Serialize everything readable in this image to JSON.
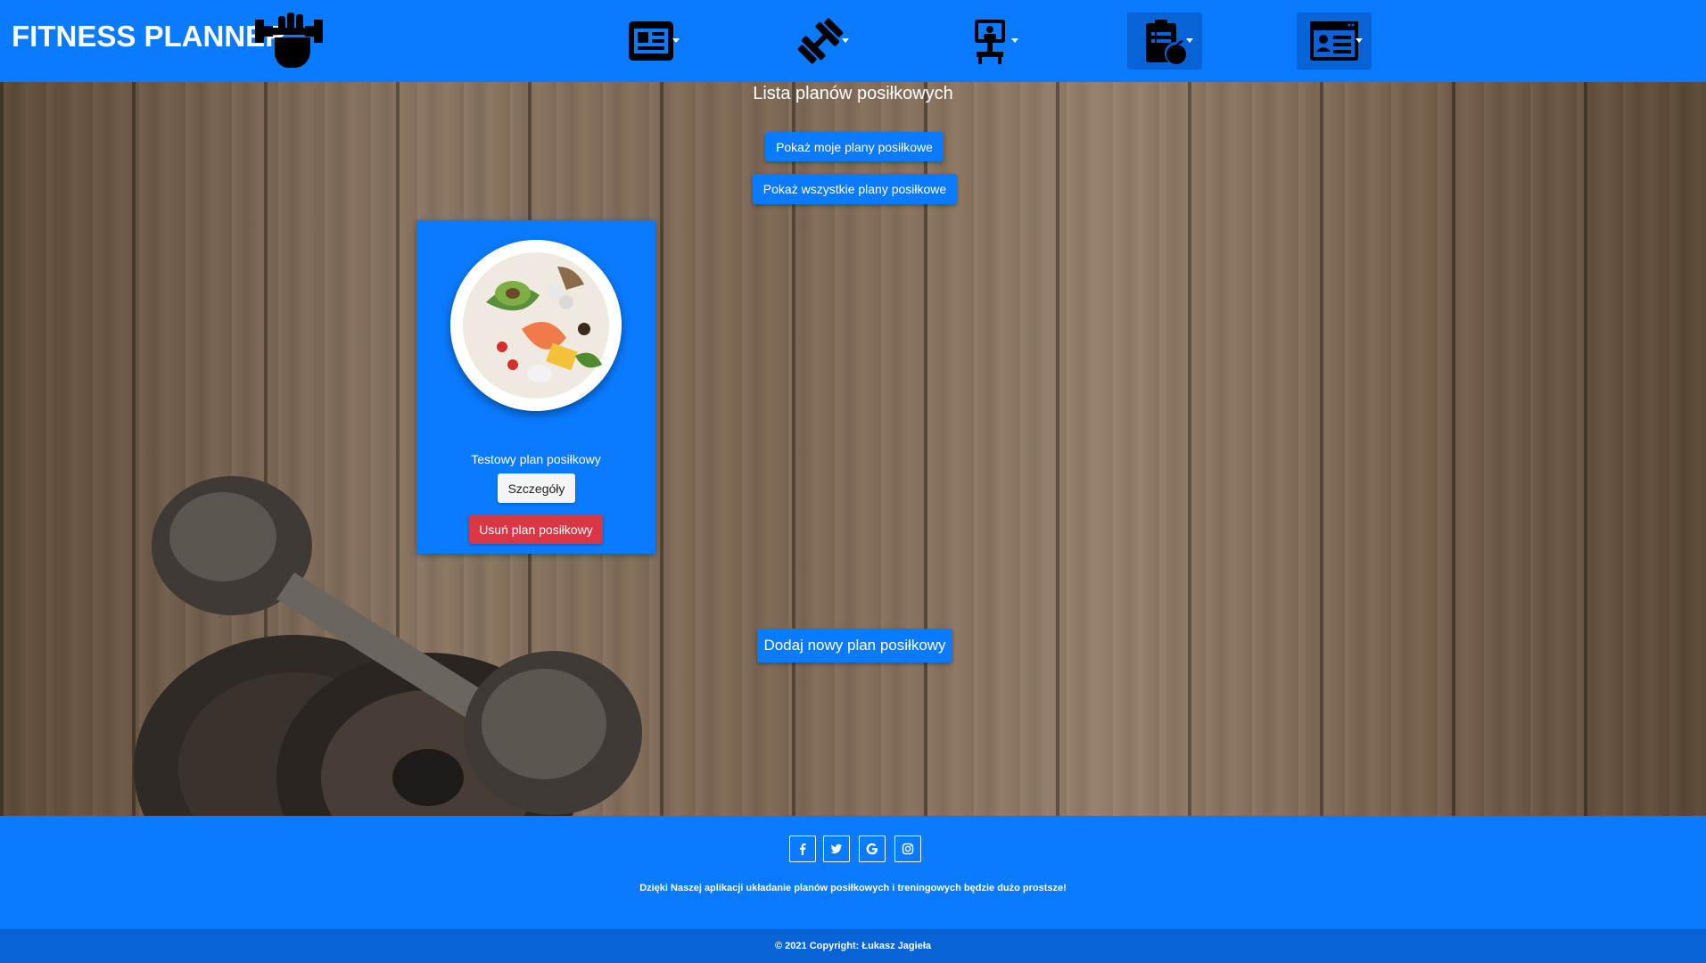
{
  "navbar": {
    "brand": "FITNESS PLANNER",
    "items": [
      {
        "icon": "news-card-icon"
      },
      {
        "icon": "dumbbell-icon"
      },
      {
        "icon": "trainer-icon"
      },
      {
        "icon": "meal-plan-clipboard-icon"
      },
      {
        "icon": "profile-card-icon"
      }
    ]
  },
  "main": {
    "title": "Lista planów posiłkowych",
    "show_my_label": "Pokaż moje plany posiłkowe",
    "show_all_label": "Pokaż wszystkie plany posiłkowe",
    "add_label": "Dodaj nowy plan posiłkowy",
    "cards": [
      {
        "title": "Testowy plan posiłkowy",
        "details_label": "Szczegóły",
        "delete_label": "Usuń plan posiłkowy"
      }
    ]
  },
  "footer": {
    "social": [
      "facebook-icon",
      "twitter-icon",
      "google-icon",
      "instagram-icon"
    ],
    "text": "Dzięki Naszej aplikacji układanie planów posiłkowych i treningowych będzie dużo prostsze!",
    "copyright": "© 2021 Copyright: Łukasz Jagieła"
  },
  "colors": {
    "primary": "#0a7bff",
    "primary_dark": "#0863d6",
    "danger": "#dc3545"
  }
}
